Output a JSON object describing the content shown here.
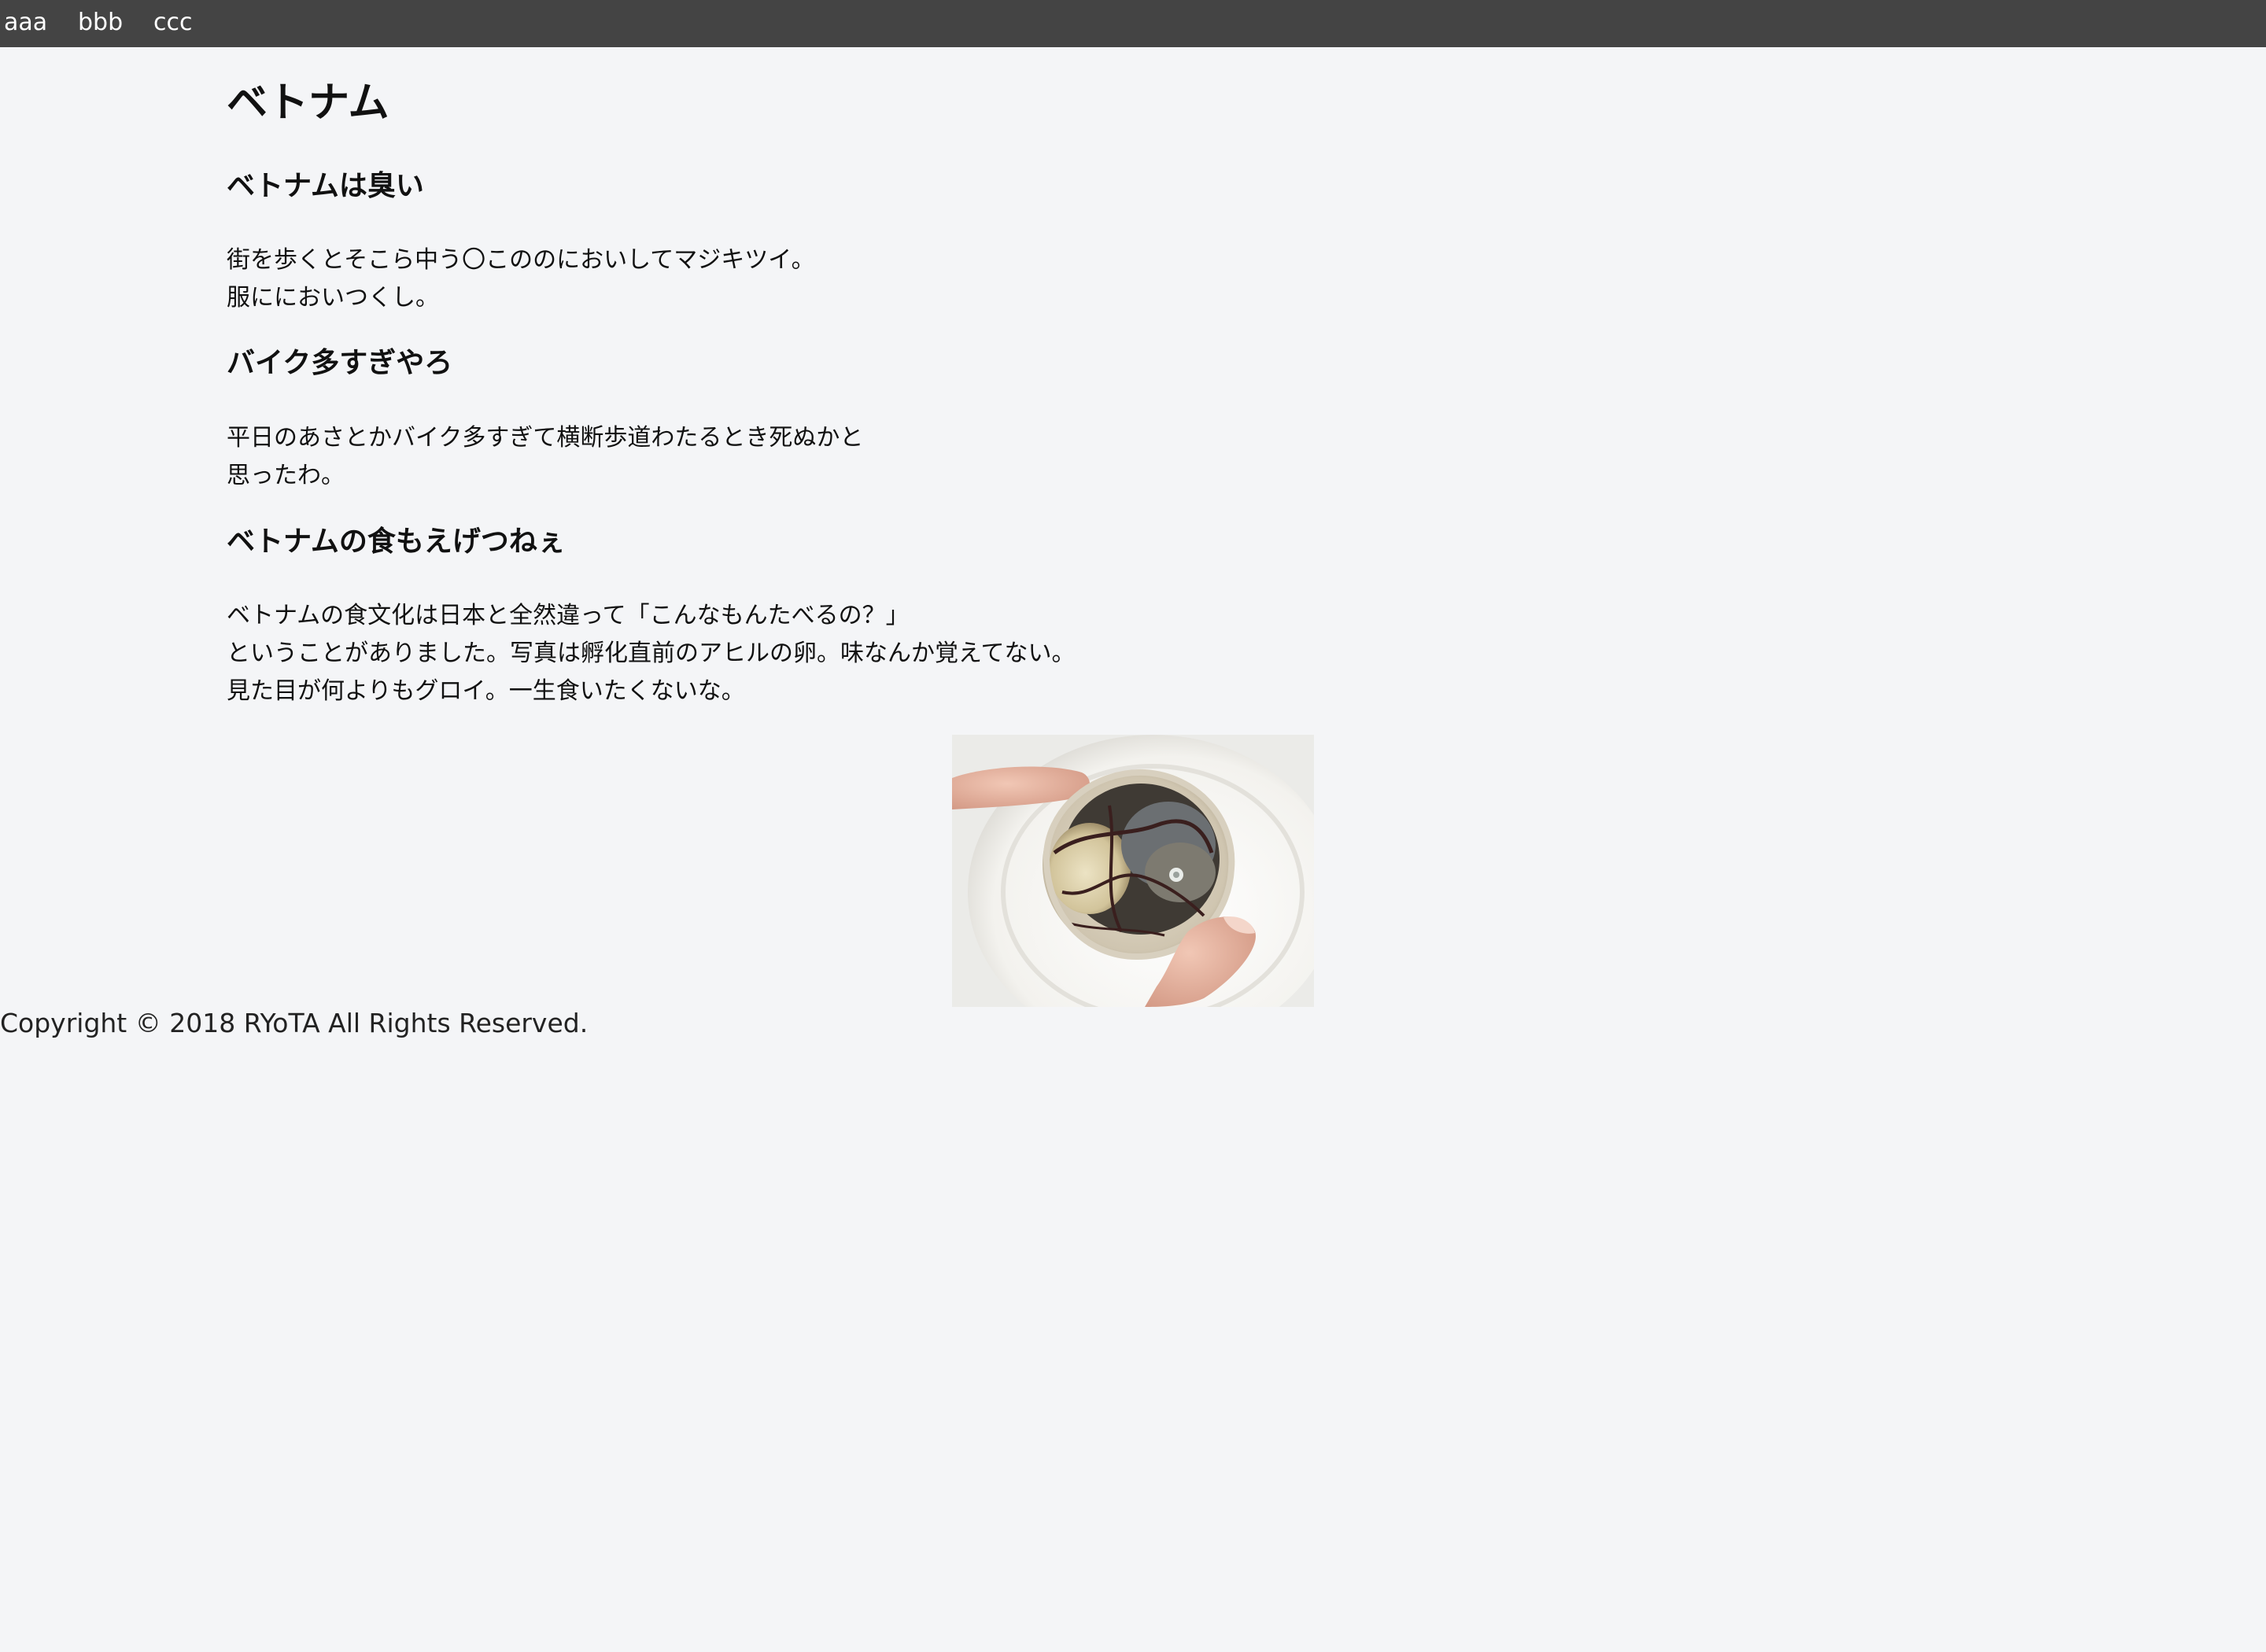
{
  "nav": {
    "items": [
      {
        "label": "aaa"
      },
      {
        "label": "bbb"
      },
      {
        "label": "ccc"
      }
    ]
  },
  "page": {
    "title": "ベトナム"
  },
  "sections": [
    {
      "heading": "ベトナムは臭い",
      "lines": [
        "街を歩くとそこら中う〇こののにおいしてマジキツイ。",
        "服ににおいつくし。"
      ]
    },
    {
      "heading": "バイク多すぎやろ",
      "lines": [
        "平日のあさとかバイク多すぎて横断歩道わたるとき死ぬかと",
        "思ったわ。"
      ]
    },
    {
      "heading": "ベトナムの食もえげつねぇ",
      "lines": [
        "ベトナムの食文化は日本と全然違って「こんなもんたべるの？」",
        "ということがありました。写真は孵化直前のアヒルの卵。味なんか覚えてない。",
        "見た目が何よりもグロイ。一生食いたくないな。"
      ]
    }
  ],
  "footer": {
    "copyright": "Copyright © 2018 RYoTA All Rights Reserved."
  },
  "colors": {
    "nav_bg": "#444444",
    "page_bg": "#f4f5f7",
    "text": "#111111"
  }
}
